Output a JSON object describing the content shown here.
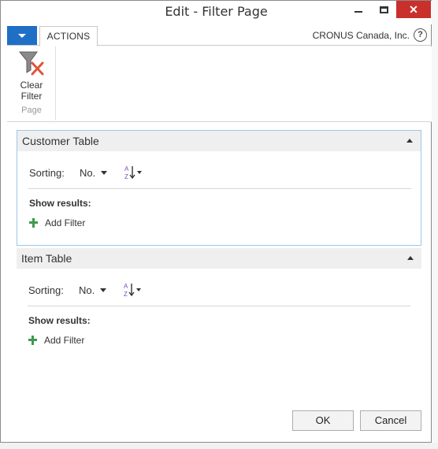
{
  "window": {
    "title": "Edit - Filter Page"
  },
  "ribbon": {
    "tab_actions": "ACTIONS",
    "company": "CRONUS Canada, Inc.",
    "help": "?",
    "clear_filter_line1": "Clear",
    "clear_filter_line2": "Filter",
    "group_label": "Page"
  },
  "sections": [
    {
      "title": "Customer Table",
      "sorting_label": "Sorting:",
      "sorting_value": "No.",
      "show_results": "Show results:",
      "add_filter": "Add Filter"
    },
    {
      "title": "Item Table",
      "sorting_label": "Sorting:",
      "sorting_value": "No.",
      "show_results": "Show results:",
      "add_filter": "Add Filter"
    }
  ],
  "footer": {
    "ok": "OK",
    "cancel": "Cancel"
  },
  "colors": {
    "accent": "#1f6fc7",
    "close": "#c9302c",
    "add_green": "#3d9a4f",
    "focus_border": "#9ec6ea"
  }
}
